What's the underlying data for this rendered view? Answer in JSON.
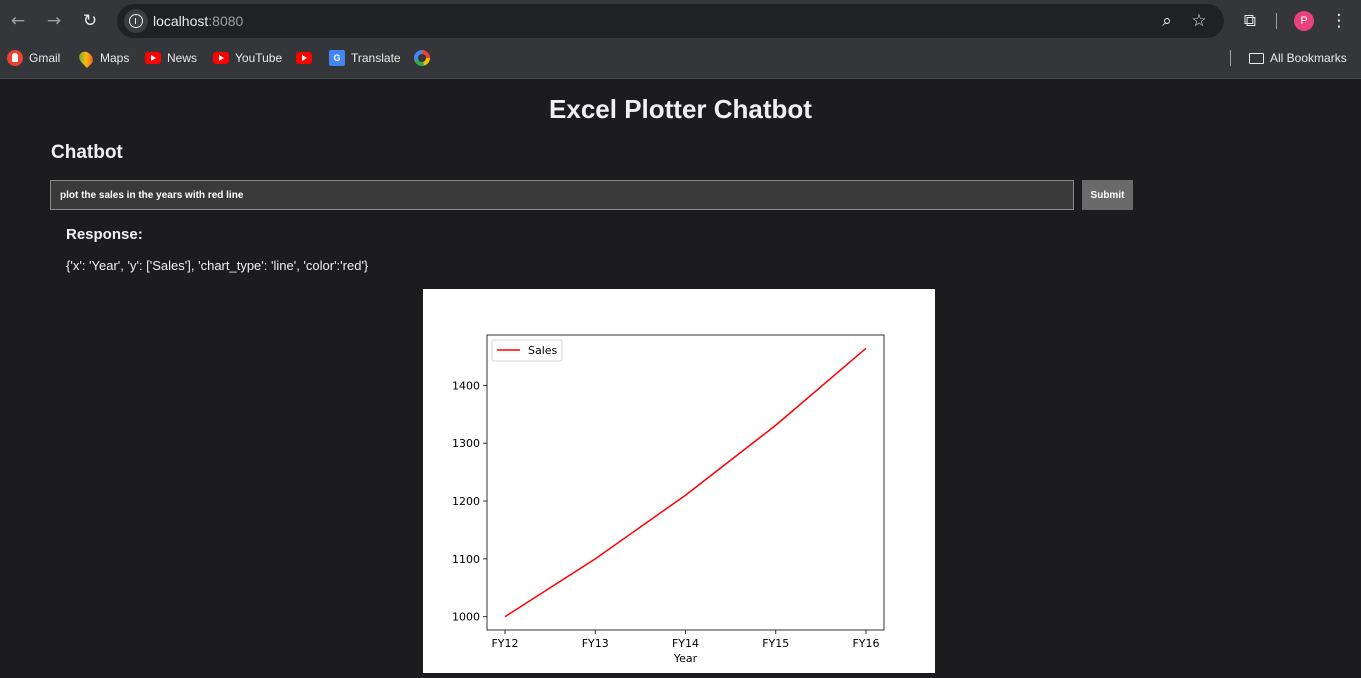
{
  "browser": {
    "url_host": "localhost",
    "url_port": ":8080",
    "avatar_letter": "P",
    "bookmarks": [
      {
        "label": "Gmail",
        "icon": "gmail-icon"
      },
      {
        "label": "Maps",
        "icon": "maps-icon"
      },
      {
        "label": "News",
        "icon": "youtube-icon"
      },
      {
        "label": "YouTube",
        "icon": "youtube-icon"
      },
      {
        "label": "",
        "icon": "youtube-icon"
      },
      {
        "label": "Translate",
        "icon": "translate-icon"
      },
      {
        "label": "",
        "icon": "google-icon"
      }
    ],
    "all_bookmarks": "All Bookmarks"
  },
  "page": {
    "title": "Excel Plotter Chatbot",
    "section_title": "Chatbot",
    "input_value": "plot the sales in the years with red line",
    "submit_label": "Submit",
    "response_title": "Response:",
    "response_text": "{'x': 'Year', 'y': ['Sales'], 'chart_type': 'line', 'color':'red'}"
  },
  "chart_data": {
    "type": "line",
    "categories": [
      "FY12",
      "FY13",
      "FY14",
      "FY15",
      "FY16"
    ],
    "series": [
      {
        "name": "Sales",
        "values": [
          1000,
          1100,
          1210,
          1331,
          1464
        ],
        "color": "#ff0000"
      }
    ],
    "title": "",
    "xlabel": "Year",
    "ylabel": "",
    "yticks": [
      1000,
      1100,
      1200,
      1300,
      1400
    ],
    "ylim": [
      977,
      1487
    ],
    "grid": false,
    "legend_position": "top-left"
  }
}
